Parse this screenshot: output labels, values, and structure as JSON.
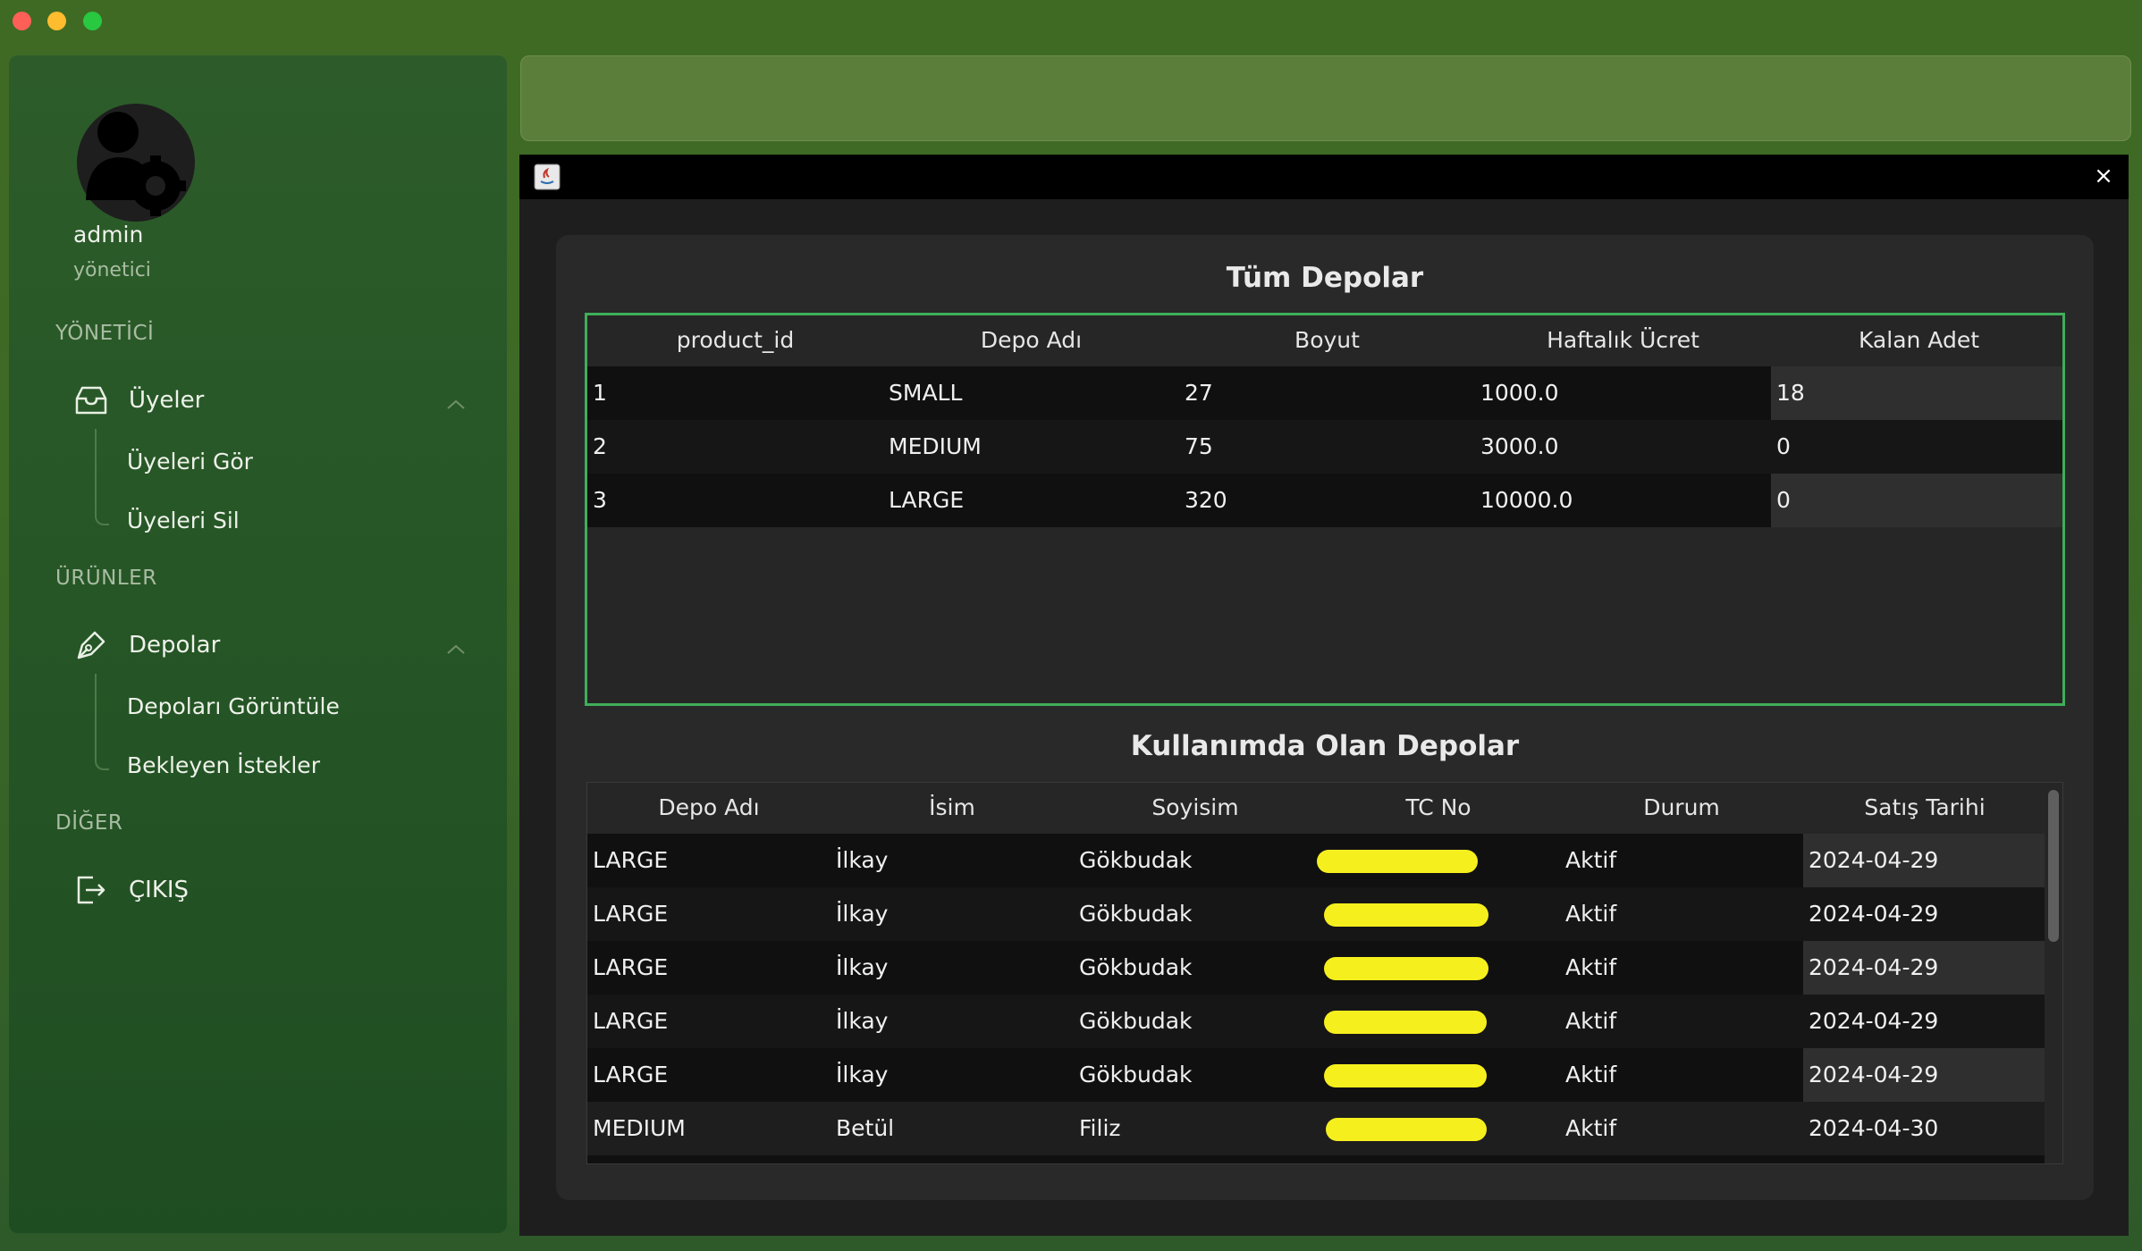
{
  "sidebar": {
    "username": "admin",
    "role": "yönetici",
    "sections": {
      "admin": "YÖNETİCİ",
      "products": "ÜRÜNLER",
      "other": "DİĞER"
    },
    "members": {
      "label": "Üyeler",
      "icon": "inbox-icon",
      "sub": [
        "Üyeleri Gör",
        "Üyeleri Sil"
      ]
    },
    "depots": {
      "label": "Depolar",
      "icon": "pen-icon",
      "sub": [
        "Depoları Görüntüle",
        "Bekleyen İstekler"
      ]
    },
    "logout": {
      "label": "ÇIKIŞ",
      "icon": "logout-icon"
    }
  },
  "dialog": {
    "close": "×",
    "all_depots": {
      "title": "Tüm Depolar",
      "columns": [
        "product_id",
        "Depo Adı",
        "Boyut",
        "Haftalık Ücret",
        "Kalan Adet"
      ],
      "rows": [
        [
          "1",
          "SMALL",
          "27",
          "1000.0",
          "18"
        ],
        [
          "2",
          "MEDIUM",
          "75",
          "3000.0",
          "0"
        ],
        [
          "3",
          "LARGE",
          "320",
          "10000.0",
          "0"
        ]
      ]
    },
    "in_use": {
      "title": "Kullanımda Olan Depolar",
      "columns": [
        "Depo Adı",
        "İsim",
        "Soyisim",
        "TC No",
        "Durum",
        "Satış Tarihi"
      ],
      "rows": [
        [
          "LARGE",
          "İlkay",
          "Gökbudak",
          "",
          "Aktif",
          "2024-04-29"
        ],
        [
          "LARGE",
          "İlkay",
          "Gökbudak",
          "",
          "Aktif",
          "2024-04-29"
        ],
        [
          "LARGE",
          "İlkay",
          "Gökbudak",
          "",
          "Aktif",
          "2024-04-29"
        ],
        [
          "LARGE",
          "İlkay",
          "Gökbudak",
          "",
          "Aktif",
          "2024-04-29"
        ],
        [
          "LARGE",
          "İlkay",
          "Gökbudak",
          "",
          "Aktif",
          "2024-04-29"
        ],
        [
          "MEDIUM",
          "Betül",
          "Filiz",
          "",
          "Aktif",
          "2024-04-30"
        ]
      ]
    }
  },
  "colors": {
    "accent_border": "#3fae5a",
    "redaction": "#f6ef1e"
  }
}
